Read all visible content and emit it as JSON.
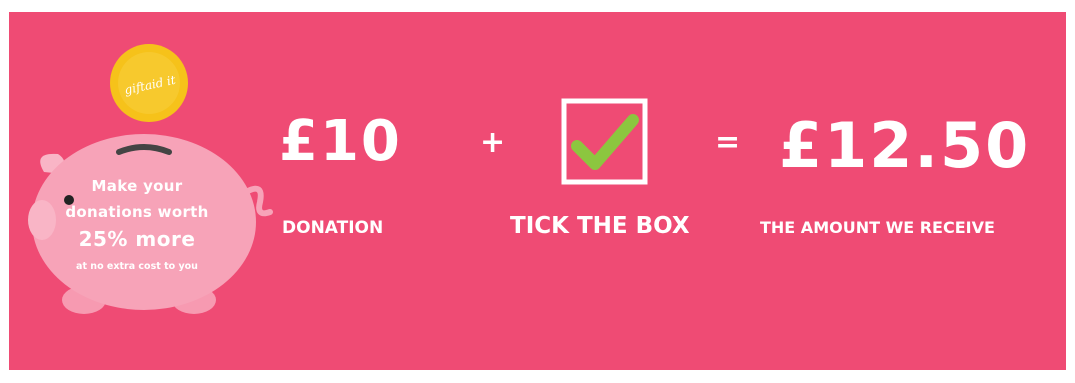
{
  "logo": {
    "coin_text": "giftaid it"
  },
  "piggy_bank": {
    "line1": "Make your",
    "line2": "donations worth",
    "line3": "25% more",
    "line4": "at no extra cost to you"
  },
  "equation": {
    "donation_amount": "£10",
    "plus_sign": "+",
    "equals_sign": "=",
    "received_amount": "£12.50"
  },
  "labels": {
    "donation": "DONATION",
    "tick_the_box": "TICK THE BOX",
    "amount_received": "THE AMOUNT WE RECEIVE"
  },
  "colors": {
    "background": "#ef4b74",
    "pig": "#f7a3b8",
    "coin": "#f6c21a",
    "tick": "#8cc63f"
  },
  "icons": {
    "coin": "gift-aid-coin-icon",
    "pig": "piggy-bank-icon",
    "tick": "checkmark-icon"
  }
}
